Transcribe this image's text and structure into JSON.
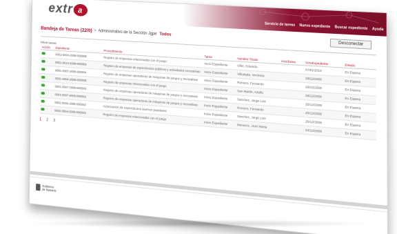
{
  "header": {
    "logo_text": "extr",
    "logo_mark": "a",
    "nav": [
      "Servicio de tareas",
      "Nuevo expediente",
      "Buscar expediente",
      "Ayuda"
    ]
  },
  "breadcrumb": {
    "main": "Bandeja de Tareas (22/0)",
    "separator": ">",
    "department": "Administrativo de la Sección Jgpe",
    "filter": "Todos"
  },
  "disconnect_label": "Desconectar",
  "filter_label": "Filtrar tareas",
  "table": {
    "columns": [
      "Acción",
      "Expediente",
      "Procedimiento",
      "Tarea",
      "Nombre Titular",
      "VctoTarea",
      "VctoExpediente",
      "Estado"
    ],
    "rows": [
      {
        "exp": "0001-0004-2008-000008",
        "proc": "Registro de empresas relacionadas con el juego",
        "task": "Inicio Expediente",
        "holder": "Olite, Eduardo",
        "vtask": "",
        "vexp": "07/01/2010",
        "state": "En Espera"
      },
      {
        "exp": "0001-0013-2008-000003",
        "proc": "Registro de empresas de espectáculos públicos y actividades recreativas",
        "task": "Inicio Expediente",
        "holder": "Villodada, Verónica",
        "vtask": "",
        "vexp": "29/12/2009",
        "state": "En Espera"
      },
      {
        "exp": "0001-0007-2008-000004",
        "proc": "Registro de empresas operadoras de máquinas de juegos y recreativas",
        "task": "Inicio Expediente",
        "holder": "Romero, Fernando",
        "vtask": "",
        "vexp": "29/12/2009",
        "state": "En Espera"
      },
      {
        "exp": "0001-0004-2008-000008",
        "proc": "Registro de empresas relacionadas con el juego",
        "task": "Inicio Expediente",
        "holder": "San Martín, Adolfo",
        "vtask": "",
        "vexp": "28/12/2009",
        "state": "En Espera"
      },
      {
        "exp": "0001-0007-2008-000003",
        "proc": "Registro de empresas operadoras de máquinas de juegos y recreativas",
        "task": "Inicio Expediente",
        "holder": "Sanchez, Jorge Luis",
        "vtask": "",
        "vexp": "25/12/2009",
        "state": "En Espera"
      },
      {
        "exp": "0001-0007-2008-000002",
        "proc": "Registro de empresas operadoras de máquinas de juegos y recreativas",
        "task": "Inicio Expediente",
        "holder": "Romero, Fernando",
        "vtask": "",
        "vexp": "25/12/2009",
        "state": "En Espera"
      },
      {
        "exp": "0001-0036-2008-000002",
        "proc": "Autorización de espectáculos taurinos populares",
        "task": "Inicio Expediente",
        "holder": "Sanchez, Jorge Luis",
        "vtask": "",
        "vexp": "25/12/2009",
        "state": "En Espera"
      },
      {
        "exp": "0001-0004-2008-000003",
        "proc": "Registro de empresas relacionadas con el juego",
        "task": "Inicio Expediente",
        "holder": "Munarriz, José María",
        "vtask": "",
        "vexp": "24/12/2009",
        "state": "En Espera"
      }
    ]
  },
  "pager": [
    "1",
    "2",
    "3"
  ],
  "footer": {
    "line1": "Gobierno",
    "line2": "de Navarra"
  },
  "colors": {
    "brand": "#8b1230",
    "accent": "#b0122e",
    "status_dot": "#3aa537"
  }
}
